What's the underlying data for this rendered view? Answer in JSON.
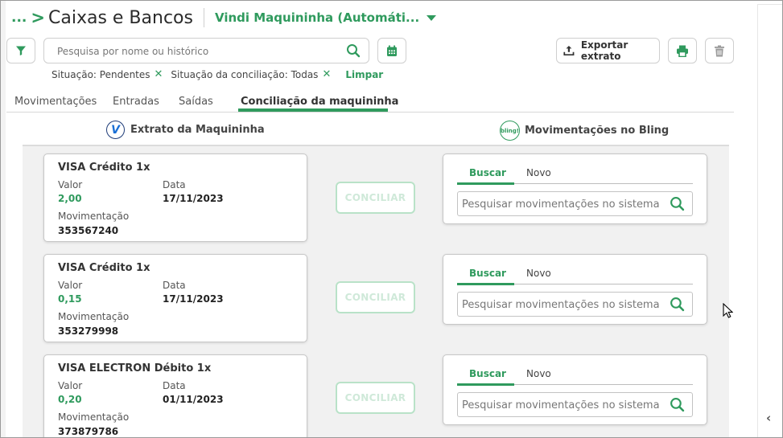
{
  "header": {
    "breadcrumb": "...",
    "title": "Caixas e Bancos",
    "account": "Vindi Maquininha (Automáti..."
  },
  "search": {
    "placeholder": "Pesquisa por nome ou histórico"
  },
  "toolbar": {
    "export_label": "Exportar extrato"
  },
  "filters": {
    "chips": [
      {
        "label": "Situação: Pendentes"
      },
      {
        "label": "Situação da conciliação: Todas"
      }
    ],
    "clear_label": "Limpar"
  },
  "tabs": [
    {
      "label": "Movimentações"
    },
    {
      "label": "Entradas"
    },
    {
      "label": "Saídas"
    },
    {
      "label": "Conciliação da maquininha"
    }
  ],
  "columns": {
    "left_title": "Extrato da Maquininha",
    "right_title": "Movimentações no Bling",
    "left_logo": "V",
    "right_logo": "bling!"
  },
  "labels": {
    "valor": "Valor",
    "data": "Data",
    "movimentacao": "Movimentação",
    "conciliar": "CONCILIAR",
    "buscar": "Buscar",
    "novo": "Novo",
    "search_placeholder": "Pesquisar movimentações no sistema"
  },
  "transactions": [
    {
      "name": "VISA Crédito 1x",
      "valor": "2,00",
      "data": "17/11/2023",
      "movimentacao": "353567240"
    },
    {
      "name": "VISA Crédito 1x",
      "valor": "0,15",
      "data": "17/11/2023",
      "movimentacao": "353279998"
    },
    {
      "name": "VISA ELECTRON Débito 1x",
      "valor": "0,20",
      "data": "01/11/2023",
      "movimentacao": "373879786"
    }
  ],
  "colors": {
    "accent": "#2f9a5d"
  }
}
